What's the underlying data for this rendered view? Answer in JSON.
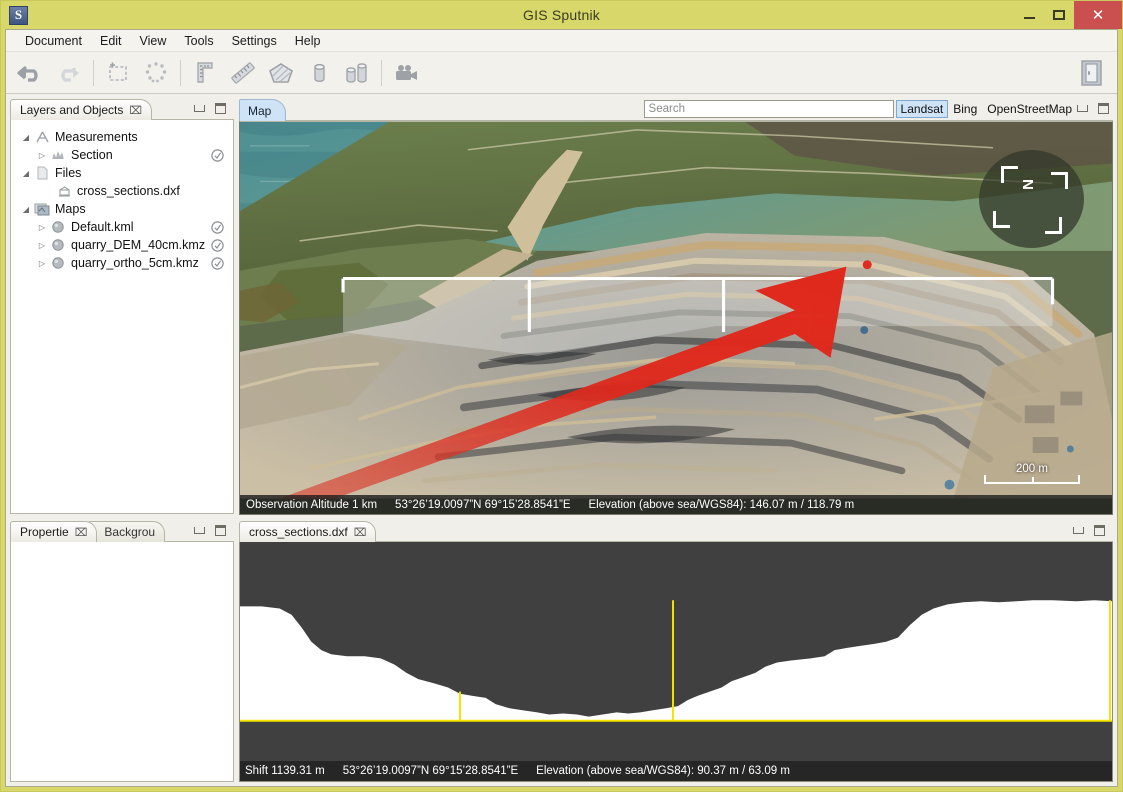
{
  "window": {
    "app_icon_letter": "S",
    "title": "GIS Sputnik",
    "minimize_label": "Minimize",
    "maximize_label": "Maximize",
    "close_label": "✕"
  },
  "menu": {
    "items": [
      {
        "label": "Document"
      },
      {
        "label": "Edit"
      },
      {
        "label": "View"
      },
      {
        "label": "Tools"
      },
      {
        "label": "Settings"
      },
      {
        "label": "Help"
      }
    ]
  },
  "toolbar": {
    "buttons": [
      {
        "name": "undo-icon",
        "title": "Undo"
      },
      {
        "name": "redo-icon",
        "title": "Redo"
      },
      {
        "name": "rectangle-select-icon",
        "title": "Rectangle area"
      },
      {
        "name": "polygon-points-icon",
        "title": "Polygon points"
      },
      {
        "name": "ruler-corner-icon",
        "title": "Angle / corner measure"
      },
      {
        "name": "ruler-icon",
        "title": "Distance measure"
      },
      {
        "name": "area-polygon-icon",
        "title": "Area measure"
      },
      {
        "name": "cylinder-icon",
        "title": "Volume"
      },
      {
        "name": "bar-volume-icon",
        "title": "Profile / section"
      },
      {
        "name": "video-camera-icon",
        "title": "Record flight"
      },
      {
        "name": "exit-door-icon",
        "title": "Exit"
      }
    ]
  },
  "layers_panel": {
    "tab_label": "Layers and Objects",
    "close_glyph": "⌧",
    "tree": [
      {
        "indent": 0,
        "twist": "◢",
        "icon": "measurements-icon",
        "label": "Measurements",
        "visibility": false
      },
      {
        "indent": 1,
        "twist": "▷",
        "icon": "section-icon",
        "label": "Section",
        "visibility": true
      },
      {
        "indent": 0,
        "twist": "◢",
        "icon": "file-icon",
        "label": "Files",
        "visibility": false
      },
      {
        "indent": 1,
        "twist": "",
        "icon": "dxf-icon",
        "label": "cross_sections.dxf",
        "visibility": false
      },
      {
        "indent": 0,
        "twist": "◢",
        "icon": "maps-icon",
        "label": "Maps",
        "visibility": false
      },
      {
        "indent": 1,
        "twist": "▷",
        "icon": "globe-icon",
        "label": "Default.kml",
        "visibility": true
      },
      {
        "indent": 1,
        "twist": "▷",
        "icon": "globe-icon",
        "label": "quarry_DEM_40cm.kmz",
        "visibility": true
      },
      {
        "indent": 1,
        "twist": "▷",
        "icon": "globe-icon",
        "label": "quarry_ortho_5cm.kmz",
        "visibility": true
      }
    ]
  },
  "properties_panel": {
    "tabs": [
      {
        "label": "Propertie",
        "active": true,
        "close_glyph": "⌧"
      },
      {
        "label": "Backgrou",
        "active": false,
        "close_glyph": ""
      }
    ]
  },
  "map_panel": {
    "tab_label": "Map",
    "search": {
      "placeholder": "Search",
      "value": ""
    },
    "basemaps": [
      {
        "label": "Landsat",
        "active": true
      },
      {
        "label": "Bing",
        "active": false
      },
      {
        "label": "OpenStreetMap",
        "active": false
      }
    ],
    "compass": {
      "north_label": "N"
    },
    "scalebar": {
      "label": "200 m"
    },
    "status": {
      "altitude": "Observation Altitude 1 km",
      "coordinates": "53°26’19.0097”N 69°15’28.8541”E",
      "elevation": "Elevation (above sea/WGS84): 146.07 m / 118.79 m"
    }
  },
  "cross_section_panel": {
    "tab_label": "cross_sections.dxf",
    "close_glyph": "⌧",
    "status": {
      "shift": "Shift 1139.31 m",
      "coordinates": "53°26’19.0097”N 69°15’28.8541”E",
      "elevation": "Elevation (above sea/WGS84): 90.37 m / 63.09 m"
    },
    "profile_color": "#ffffff",
    "background_color": "#404040",
    "cursor_color": "#f5e400"
  },
  "colors": {
    "title_bar": "#d8d86a",
    "close_button": "#c9504f",
    "accent_tab": "#cfe3f7",
    "annotation_arrow": "#e02b20",
    "section_line": "#ffffff"
  }
}
